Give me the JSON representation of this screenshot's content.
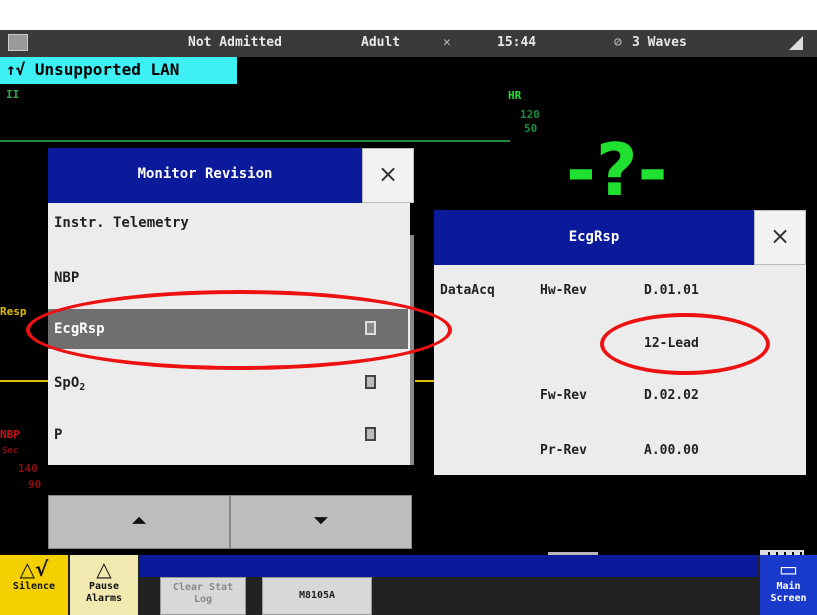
{
  "topbar": {
    "status": "Not Admitted",
    "patient_category": "Adult",
    "time": "15:44",
    "waves": "3 Waves"
  },
  "lan_banner": {
    "text": "↑√ Unsupported LAN"
  },
  "waveforms": {
    "lead_label": "II",
    "resp_label": "Resp",
    "nbp_label": "NBP",
    "hr": {
      "label": "HR",
      "upper": "120",
      "lower": "50",
      "value": "-?-"
    }
  },
  "monitor_revision": {
    "title": "Monitor Revision",
    "close": "×",
    "items": [
      {
        "label": "Instr. Telemetry"
      },
      {
        "label": "NBP"
      },
      {
        "label": "EcgRsp"
      },
      {
        "label_main": "SpO",
        "label_sub": "2"
      },
      {
        "label": "P"
      }
    ],
    "page_up": "⏶",
    "page_down": "⏷"
  },
  "ecgrsp": {
    "title": "EcgRsp",
    "close": "×",
    "group": "DataAcq",
    "hw_label": "Hw-Rev",
    "hw_value": "D.01.01",
    "option": "12-Lead",
    "fw_label": "Fw-Rev",
    "fw_value": "D.02.02",
    "pr_label": "Pr-Rev",
    "pr_value": "A.00.00"
  },
  "bottom": {
    "silence": "Silence",
    "pause": "Pause Alarms",
    "clear_stat_log": "Clear Stat Log",
    "model": "M8105A",
    "main_screen": "Main Screen"
  },
  "colors": {
    "dialog_header": "#0a1a9a",
    "lan_banner": "#3cf0f4",
    "hr_value": "#20e030",
    "annotation": "#e11111",
    "silence_key": "#f4d000"
  }
}
